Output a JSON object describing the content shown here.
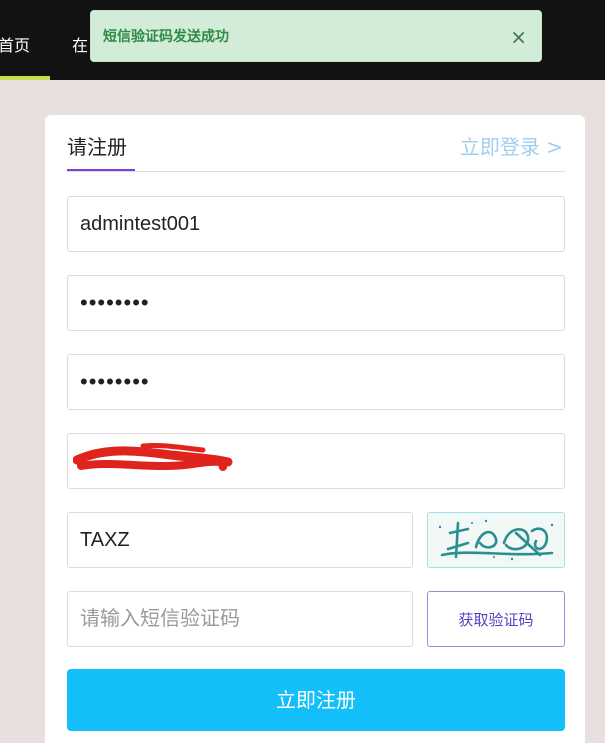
{
  "nav": {
    "home_label": "首页",
    "other_label": "在"
  },
  "toast": {
    "message": "短信验证码发送成功",
    "close_glyph": "×"
  },
  "register": {
    "tab_title": "请注册",
    "login_link": "立即登录 >",
    "username_value": "admintest001",
    "password_value": "password",
    "confirm_password_value": "password",
    "captcha_value": "TAXZ",
    "sms_placeholder": "请输入短信验证码",
    "sms_button": "获取验证码",
    "submit_button": "立即注册"
  },
  "colors": {
    "accent": "#12bff8",
    "tab_underline": "#7b3fe0",
    "toast_bg": "#d2ecd8",
    "nav_bg": "#121212",
    "redaction": "#e0241d"
  }
}
